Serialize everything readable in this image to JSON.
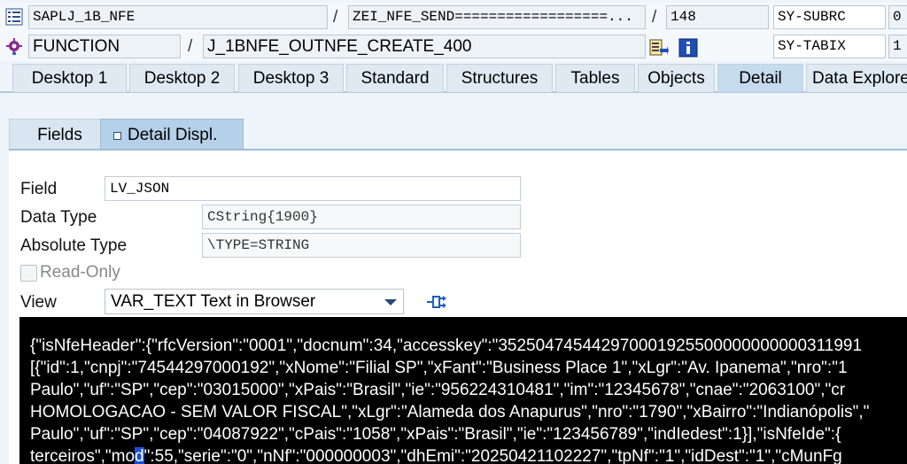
{
  "header": {
    "program": "SAPLJ_1B_NFE",
    "include": "ZEI_NFE_SEND==================...",
    "line": "148",
    "subrc_label": "SY-SUBRC",
    "subrc_value": "0",
    "event_type": "FUNCTION",
    "event_name": "J_1BNFE_OUTNFE_CREATE_400",
    "tabix_label": "SY-TABIX",
    "tabix_value": "1"
  },
  "desktop_tabs": [
    {
      "label": "Desktop 1"
    },
    {
      "label": "Desktop 2"
    },
    {
      "label": "Desktop 3"
    },
    {
      "label": "Standard"
    },
    {
      "label": "Structures"
    },
    {
      "label": "Tables"
    },
    {
      "label": "Objects"
    },
    {
      "label": "Detail"
    },
    {
      "label": "Data Explorer"
    }
  ],
  "subtabs": {
    "fields": "Fields",
    "detail": "Detail Displ."
  },
  "detail": {
    "field_label": "Field",
    "field_value": "LV_JSON",
    "datatype_label": "Data Type",
    "datatype_value": "CString{1900}",
    "abstype_label": "Absolute Type",
    "abstype_value": "\\TYPE=STRING",
    "readonly_label": "Read-Only",
    "view_label": "View",
    "view_value": "VAR_TEXT Text in Browser"
  },
  "json_lines": [
    "{\"isNfeHeader\":{\"rfcVersion\":\"0001\",\"docnum\":34,\"accesskey\":\"352504745442970001925500000000000311991",
    "[{\"id\":1,\"cnpj\":\"74544297000192\",\"xNome\":\"Filial SP\",\"xFant\":\"Business Place 1\",\"xLgr\":\"Av. Ipanema\",\"nro\":\"1",
    "Paulo\",\"uf\":\"SP\",\"cep\":\"03015000\",\"xPais\":\"Brasil\",\"ie\":\"956224310481\",\"im\":\"12345678\",\"cnae\":\"2063100\",\"cr",
    "HOMOLOGACAO - SEM VALOR FISCAL\",\"xLgr\":\"Alameda dos Anapurus\",\"nro\":\"1790\",\"xBairro\":\"Indianópolis\",\"",
    "Paulo\",\"uf\":\"SP\",\"cep\":\"04087922\",\"cPais\":\"1058\",\"xPais\":\"Brasil\",\"ie\":\"123456789\",\"indIedest\":1}],\"isNfeIde\":{",
    {
      "before": "terceiros\",\"mo",
      "cursor": "d",
      "after": "\":55,\"serie\":\"0\",\"nNf\":\"000000003\",\"dhEmi\":\"20250421102227\",\"tpNf\":\"1\",\"idDest\":\"1\",\"cMunFg"
    }
  ],
  "icons": [
    "program-icon",
    "function-icon",
    "variables-icon",
    "info-icon",
    "export-icon",
    "dropdown-caret-icon"
  ],
  "colors": {
    "active_tab": "#c6dbee",
    "panel_border": "#9fbcd6",
    "browser_bg": "#000000"
  }
}
